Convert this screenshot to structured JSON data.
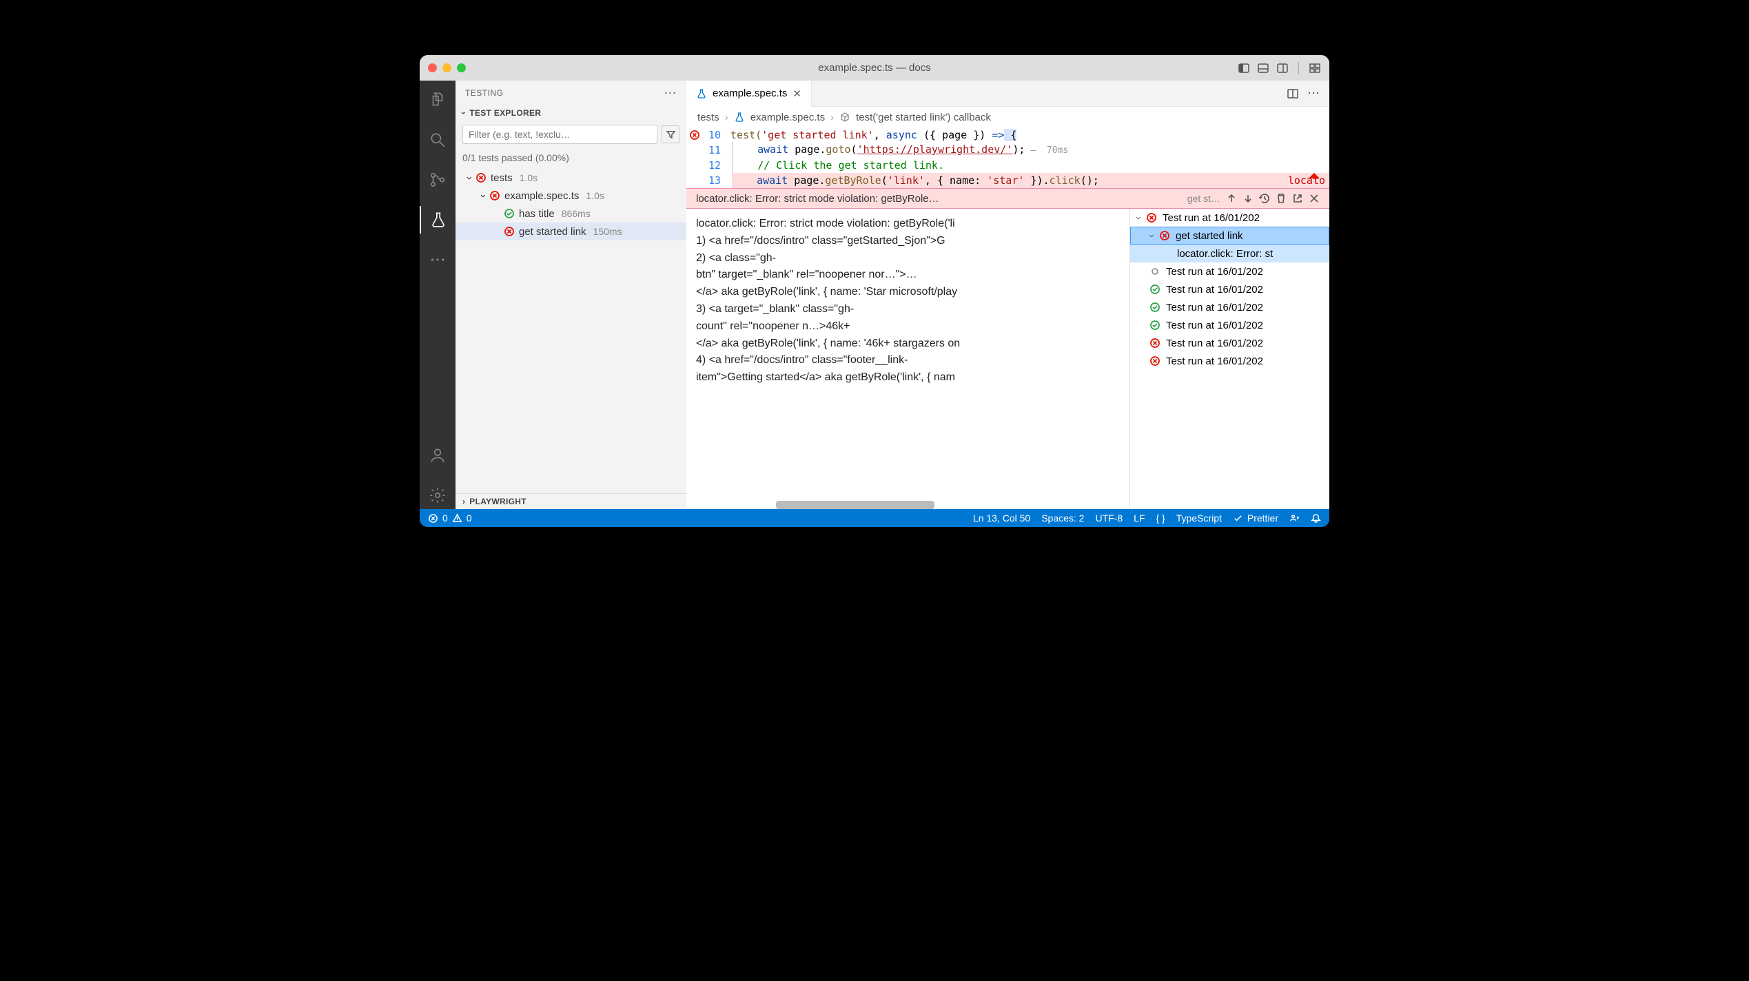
{
  "title": "example.spec.ts — docs",
  "sidebar": {
    "header": "TESTING",
    "explorer_label": "TEST EXPLORER",
    "filter_placeholder": "Filter (e.g. text, !exclu…",
    "pass_summary": "0/1 tests passed (0.00%)",
    "nodes": {
      "root_label": "tests",
      "root_dur": "1.0s",
      "file_label": "example.spec.ts",
      "file_dur": "1.0s",
      "t1_label": "has title",
      "t1_dur": "866ms",
      "t2_label": "get started link",
      "t2_dur": "150ms"
    },
    "playwright_label": "PLAYWRIGHT"
  },
  "tab": {
    "name": "example.spec.ts"
  },
  "breadcrumb": {
    "folder": "tests",
    "file": "example.spec.ts",
    "symbol": "test('get started link') callback"
  },
  "code": {
    "l10": {
      "n": "10",
      "text_pre": "test(",
      "str": "'get started link'",
      "sep": ", ",
      "kw": "async",
      "args": " ({ page }) ",
      "arrow": "=>",
      "brace": " {"
    },
    "l11": {
      "n": "11",
      "kw": "await",
      "plain1": " page.",
      "fn": "goto",
      "plain2": "(",
      "url": "'https://playwright.dev/'",
      "plain3": ");",
      "annot": "—  70ms"
    },
    "l12": {
      "n": "12",
      "cm": "// Click the get started link."
    },
    "l13": {
      "n": "13",
      "kw": "await",
      "plain1": " page.",
      "fn1": "getByRole",
      "p2": "(",
      "str1": "'link'",
      "p3": ", { name: ",
      "str2": "'star'",
      "p4": " }).",
      "fn2": "click",
      "p5": "();",
      "tail": "locato"
    }
  },
  "inline_error": {
    "summary": "locator.click: Error: strict mode violation: getByRole…",
    "sub": "get st…"
  },
  "error_body": {
    "l1": "locator.click: Error: strict mode violation: getByRole('li",
    "l2": "    1) <a href=\"/docs/intro\" class=\"getStarted_Sjon\">G",
    "l3": "    2) <a class=\"gh-",
    "l4": "btn\" target=\"_blank\" rel=\"noopener nor…\">…",
    "l5": "</a> aka getByRole('link', { name: 'Star microsoft/play",
    "l6": "    3) <a target=\"_blank\" class=\"gh-",
    "l7": "count\" rel=\"noopener n…>46k+",
    "l8": "</a> aka getByRole('link', { name: '46k+ stargazers on",
    "l9": "    4) <a href=\"/docs/intro\" class=\"footer__link-",
    "l10": "item\">Getting started</a> aka getByRole('link', { nam"
  },
  "runs": {
    "r1": "Test run at 16/01/202",
    "r2": "get started link",
    "r3": "locator.click: Error: st",
    "r4": "Test run at 16/01/202",
    "r5": "Test run at 16/01/202",
    "r6": "Test run at 16/01/202",
    "r7": "Test run at 16/01/202",
    "r8": "Test run at 16/01/202",
    "r9": "Test run at 16/01/202"
  },
  "status": {
    "errors": "0",
    "warnings": "0",
    "pos": "Ln 13, Col 50",
    "spaces": "Spaces: 2",
    "enc": "UTF-8",
    "eol": "LF",
    "lang": "TypeScript",
    "prettier": "Prettier"
  }
}
